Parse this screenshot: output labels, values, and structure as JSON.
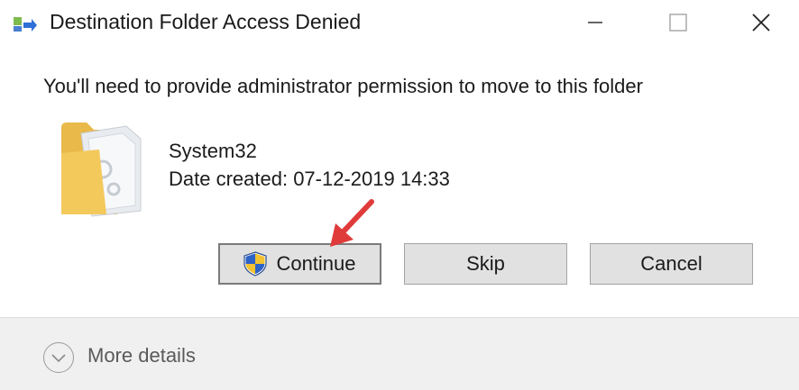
{
  "window": {
    "title": "Destination Folder Access Denied",
    "controls": {
      "minimize": "minimize-icon",
      "maximize": "maximize-icon",
      "close": "close-icon"
    }
  },
  "message": "You'll need to provide administrator permission to move to this folder",
  "item": {
    "icon": "folder-icon",
    "name": "System32",
    "date_created": "Date created: 07-12-2019 14:33"
  },
  "buttons": {
    "continue": "Continue",
    "skip": "Skip",
    "cancel": "Cancel"
  },
  "footer": {
    "more_details": "More details"
  },
  "colors": {
    "button_bg": "#e1e1e1",
    "footer_bg": "#f0f0f0",
    "arrow": "#e03b3b",
    "folder": "#f3c95c"
  }
}
